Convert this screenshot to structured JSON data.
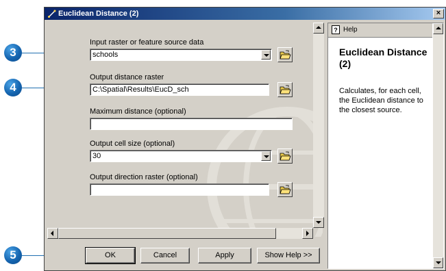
{
  "window": {
    "title": "Euclidean Distance (2)",
    "close_glyph": "×"
  },
  "callouts": [
    "3",
    "4",
    "5"
  ],
  "form": {
    "input_raster": {
      "label": "Input raster or feature source data",
      "value": "schools"
    },
    "output_distance": {
      "label": "Output distance raster",
      "value": "C:\\Spatial\\Results\\EucD_sch"
    },
    "max_distance": {
      "label": "Maximum distance (optional)",
      "value": ""
    },
    "cell_size": {
      "label": "Output cell size (optional)",
      "value": "30"
    },
    "output_direction": {
      "label": "Output direction raster (optional)",
      "value": ""
    }
  },
  "buttons": {
    "ok": "OK",
    "cancel": "Cancel",
    "apply": "Apply",
    "show_help": "Show Help >>"
  },
  "help": {
    "tab_label": "Help",
    "title": "Euclidean Distance (2)",
    "body": "Calculates, for each cell, the Euclidean distance to the closest source."
  },
  "colors": {
    "callout_accent": "#1f6fb0",
    "titlebar": "#0a246a",
    "dialog_face": "#d4d0c8"
  }
}
